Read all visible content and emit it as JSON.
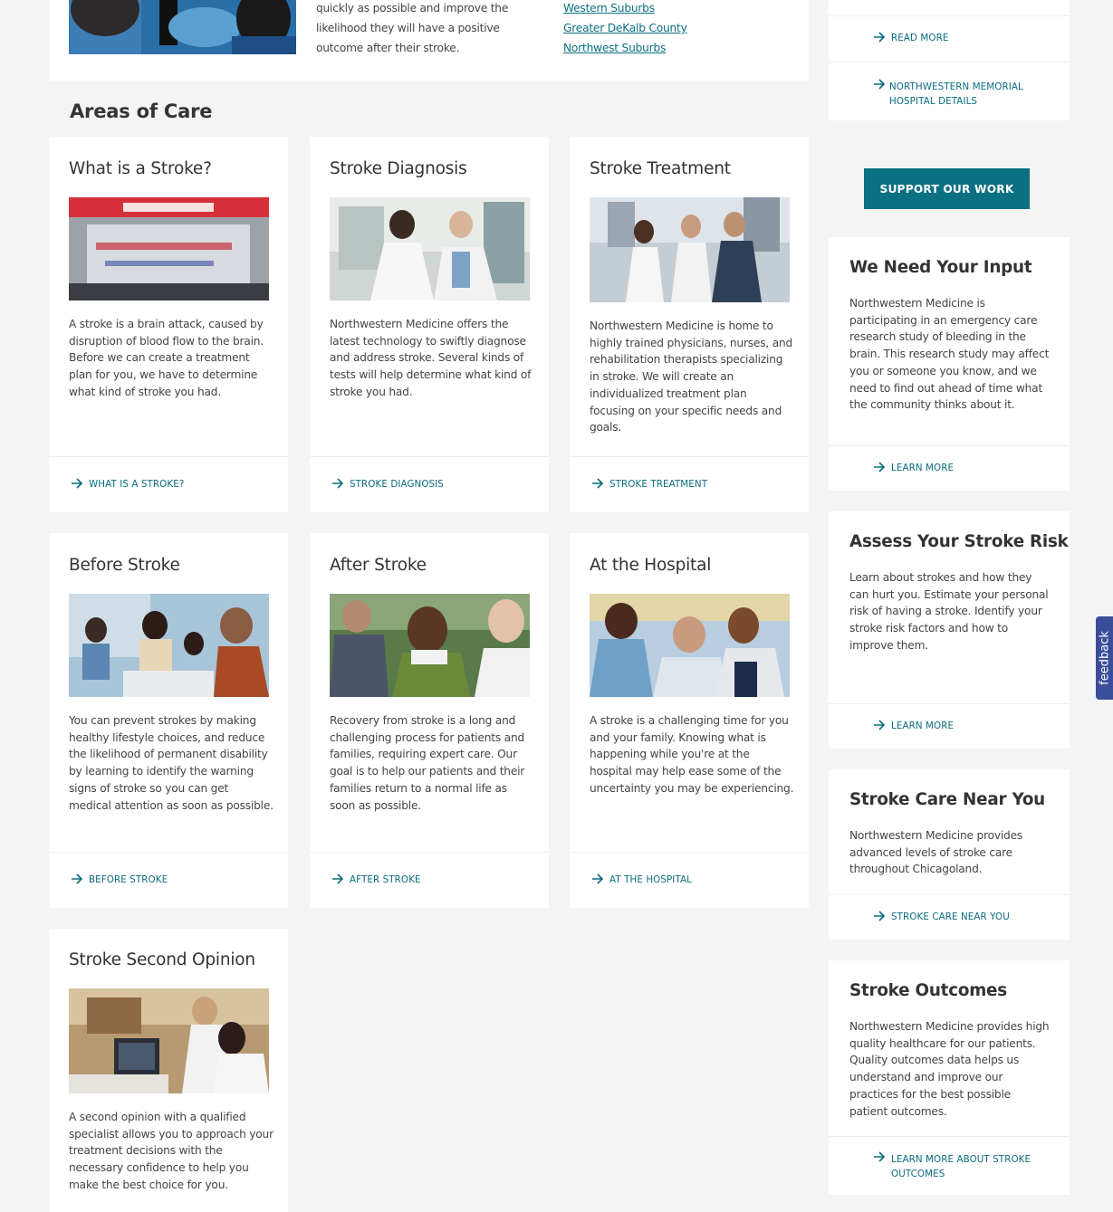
{
  "top_section": {
    "text": "quickly as possible and improve the likelihood they will have a positive outcome after their stroke.",
    "regions": [
      "Western Suburbs",
      "Greater DeKalb County",
      "Northwest Suburbs"
    ]
  },
  "areas_heading": "Areas of Care",
  "areas": [
    {
      "title": "What is a Stroke?",
      "image": "ambulance-emergency-photo",
      "desc": "A stroke is a brain attack, caused by disruption of blood flow to the brain. Before we can create a treatment plan for you, we have to determine what kind of stroke you had.",
      "link": "What is a Stroke?"
    },
    {
      "title": "Stroke Diagnosis",
      "image": "doctors-reviewing-scans-photo",
      "desc": "Northwestern Medicine offers the latest technology to swiftly diagnose and address stroke. Several kinds of tests will help determine what kind of stroke you had.",
      "link": "Stroke Diagnosis"
    },
    {
      "title": "Stroke Treatment",
      "image": "care-team-consult-photo",
      "desc": "Northwestern Medicine is home to highly trained physicians, nurses, and rehabilitation therapists specializing in stroke. We will create an individualized treatment plan focusing on your specific needs and goals.",
      "link": "Stroke Treatment"
    },
    {
      "title": "Before Stroke",
      "image": "family-meal-photo",
      "desc": "You can prevent strokes by making healthy lifestyle choices, and reduce the likelihood of permanent disability by learning to identify the warning signs of stroke so you can get medical attention as soon as possible.",
      "link": "Before Stroke"
    },
    {
      "title": "After Stroke",
      "image": "men-after-exercise-photo",
      "desc": "Recovery from stroke is a long and challenging process for patients and families, requiring expert care. Our goal is to help our patients and their families return to a normal life as soon as possible.",
      "link": "After Stroke"
    },
    {
      "title": "At the Hospital",
      "image": "patient-bedside-photo",
      "desc": "A stroke is a challenging time for you and your family. Knowing what is happening while you're at the hospital may help ease some of the uncertainty you may be experiencing.",
      "link": "At the Hospital"
    },
    {
      "title": "Stroke Second Opinion",
      "image": "specialist-consult-photo",
      "desc": "A second opinion with a qualified specialist allows you to approach your treatment decisions with the necessary confidence to help you make the best choice for you.",
      "link": ""
    }
  ],
  "sidebar": {
    "top_links": [
      "Read More",
      "Northwestern Memorial Hospital Details"
    ],
    "support_button": "Support Our Work",
    "cards": [
      {
        "title": "We Need Your Input",
        "desc": "Northwestern Medicine is participating in an emergency care research study of bleeding in the brain. This research study may affect you or someone you know, and we need to find out ahead of time what the community thinks about it.",
        "link": "Learn More"
      },
      {
        "title": "Assess Your Stroke Risk",
        "desc": "Learn about strokes and how they can hurt you. Estimate your personal risk of having a stroke. Identify your stroke risk factors and how to improve them.",
        "link": "Learn More"
      },
      {
        "title": "Stroke Care Near You",
        "desc": "Northwestern Medicine provides advanced levels of stroke care throughout Chicagoland.",
        "link": "Stroke Care Near You"
      },
      {
        "title": "Stroke Outcomes",
        "desc": "Northwestern Medicine provides high quality healthcare for our patients. Quality outcomes data helps us understand and improve our practices for the best possible patient outcomes.",
        "link": "Learn More About Stroke Outcomes"
      }
    ]
  },
  "feedback_label": "feedback",
  "colors": {
    "accent": "#0a7082",
    "background": "#f4f4f4",
    "card": "#ffffff",
    "feedback": "#3a4d9a"
  }
}
